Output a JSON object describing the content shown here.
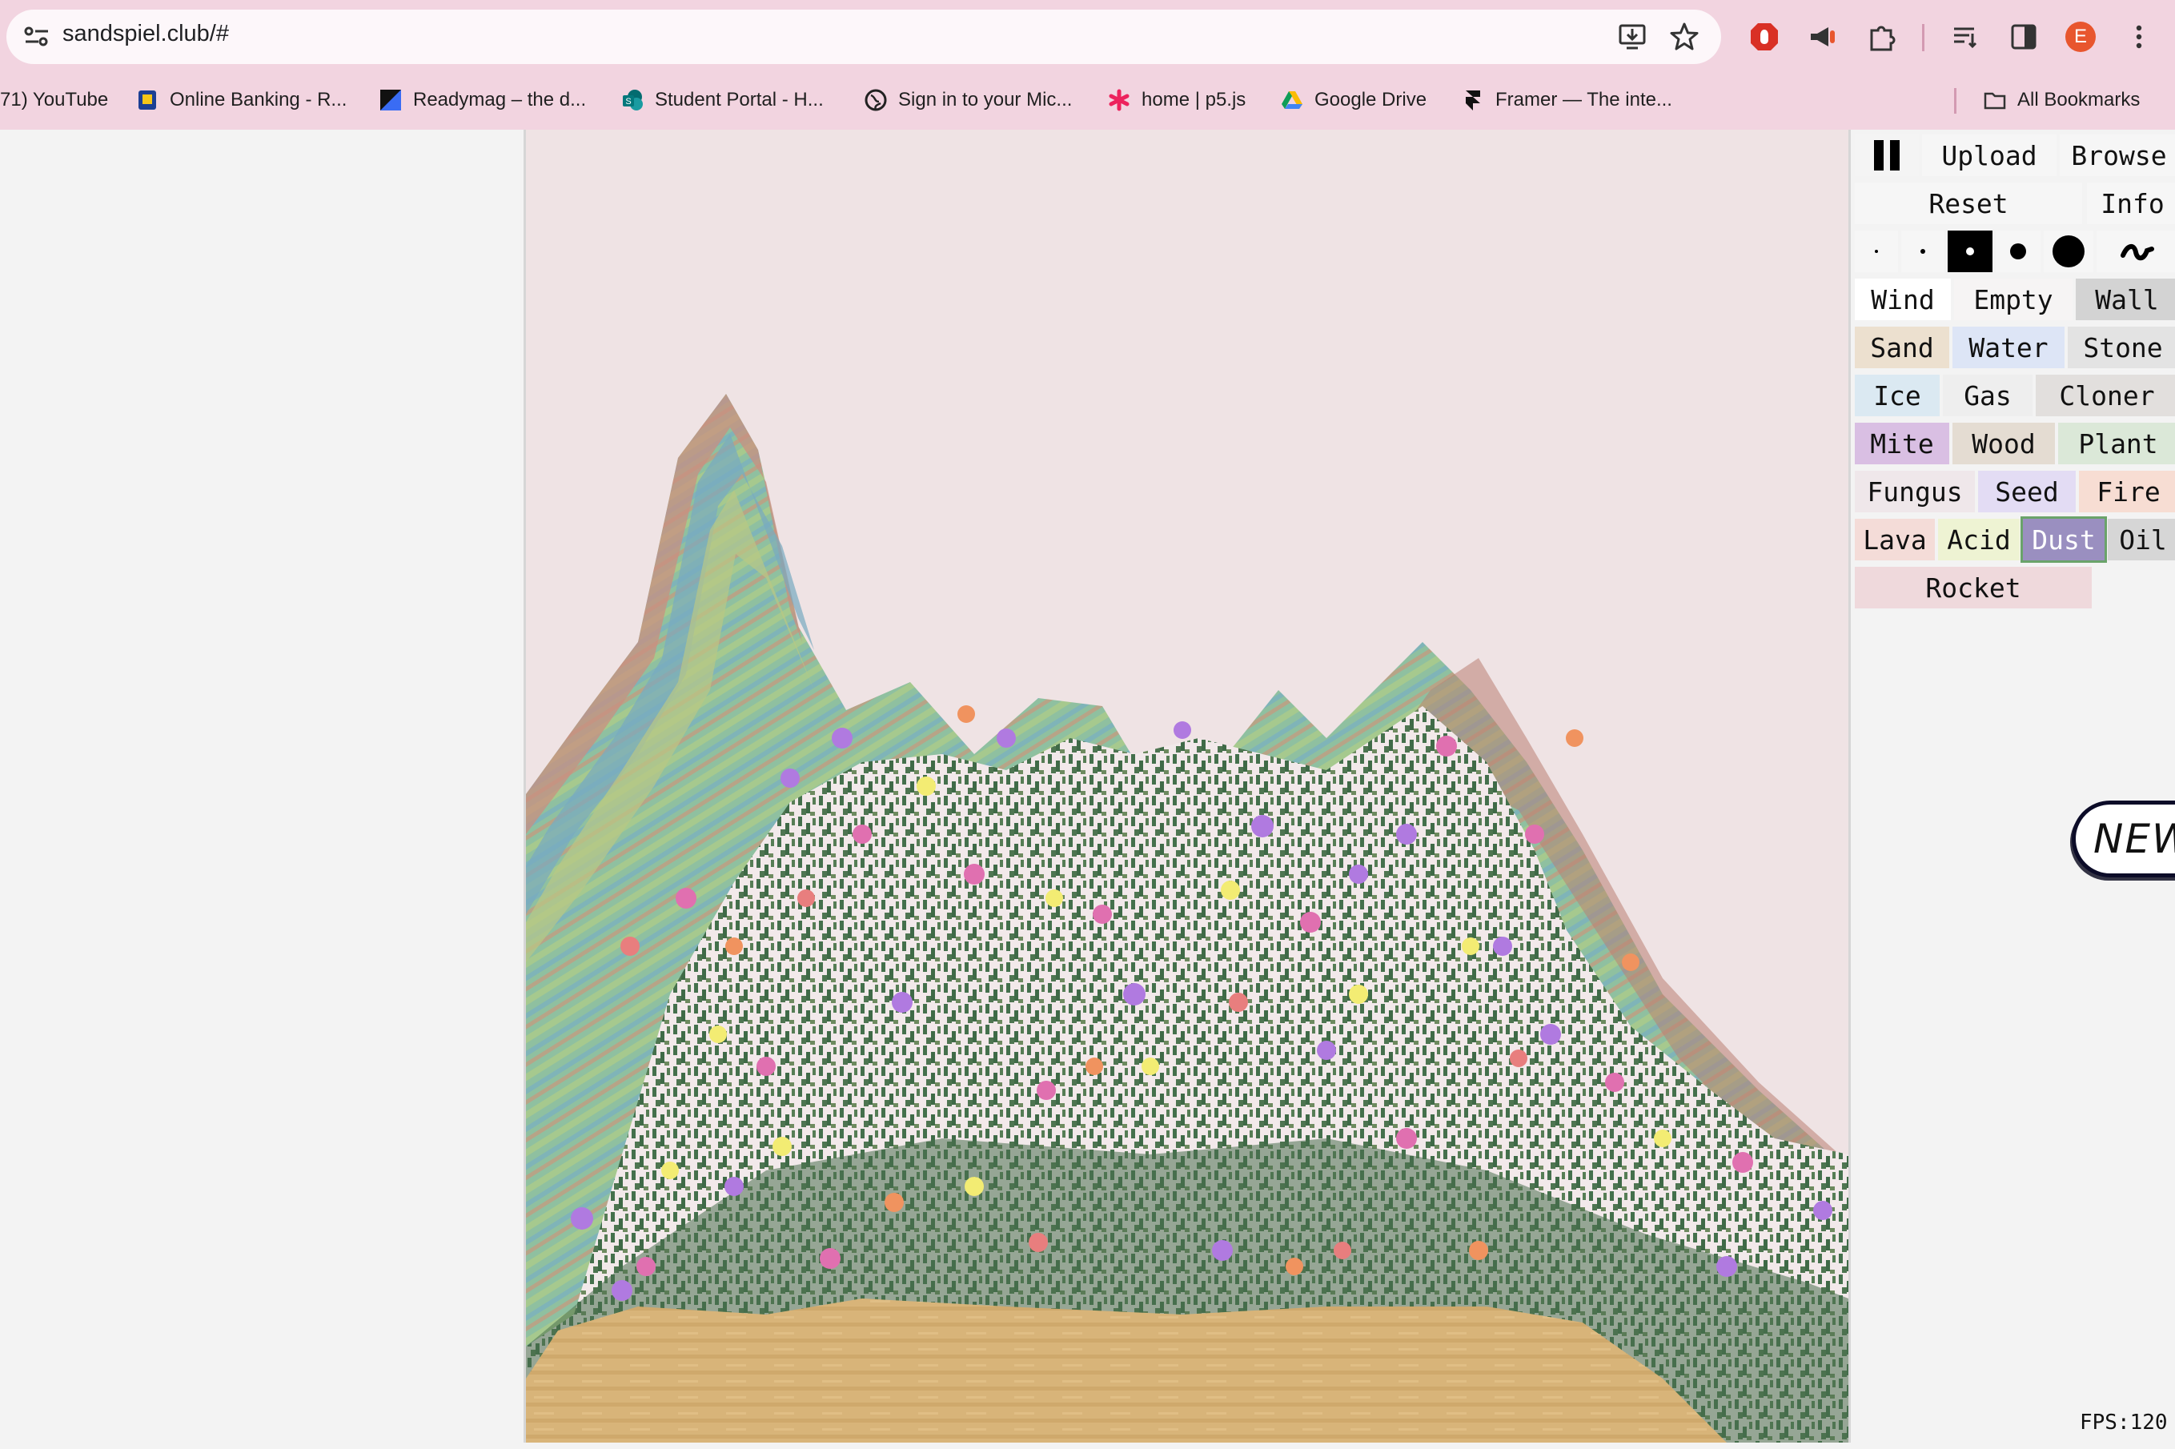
{
  "browser": {
    "url": "sandspiel.club/#",
    "profile_initial": "E",
    "bookmarks": [
      {
        "label": "71) YouTube",
        "icon": "none"
      },
      {
        "label": "Online Banking - R...",
        "icon": "bank-icon"
      },
      {
        "label": "Readymag – the d...",
        "icon": "readymag-icon"
      },
      {
        "label": "Student Portal - H...",
        "icon": "sharepoint-icon"
      },
      {
        "label": "Sign in to your Mic...",
        "icon": "globe-icon"
      },
      {
        "label": "home | p5.js",
        "icon": "asterisk-icon"
      },
      {
        "label": "Google Drive",
        "icon": "drive-icon"
      },
      {
        "label": "Framer — The inte...",
        "icon": "framer-icon"
      }
    ],
    "all_bookmarks_label": "All Bookmarks"
  },
  "controls": {
    "upload": "Upload",
    "browse": "Browse",
    "reset": "Reset",
    "info": "Info",
    "selected_size_index": 2,
    "elements": [
      {
        "label": "Wind",
        "color": "#ffffff"
      },
      {
        "label": "Empty",
        "color": "#f6f4f4"
      },
      {
        "label": "Wall",
        "color": "#d3d3d3"
      },
      {
        "label": "Sand",
        "color": "#ece0cf"
      },
      {
        "label": "Water",
        "color": "#dde5f6"
      },
      {
        "label": "Stone",
        "color": "#e3e3e3"
      },
      {
        "label": "Ice",
        "color": "#dbe9f2"
      },
      {
        "label": "Gas",
        "color": "#eeeeee"
      },
      {
        "label": "Cloner",
        "color": "#e2dfdd"
      },
      {
        "label": "Mite",
        "color": "#d9bfe3"
      },
      {
        "label": "Wood",
        "color": "#e4dcd2"
      },
      {
        "label": "Plant",
        "color": "#dbe8d8"
      },
      {
        "label": "Fungus",
        "color": "#efe7ea"
      },
      {
        "label": "Seed",
        "color": "#e3dcf4"
      },
      {
        "label": "Fire",
        "color": "#f7ddd3"
      },
      {
        "label": "Lava",
        "color": "#f4dcd8"
      },
      {
        "label": "Acid",
        "color": "#eef3d3"
      },
      {
        "label": "Dust",
        "color": "#9a8fc0"
      },
      {
        "label": "Oil",
        "color": "#d6d6d6"
      },
      {
        "label": "Rocket",
        "color": "#efd9dc"
      }
    ],
    "selected_element": "Dust"
  },
  "new_badge": "NEW",
  "fps": "FPS:120"
}
